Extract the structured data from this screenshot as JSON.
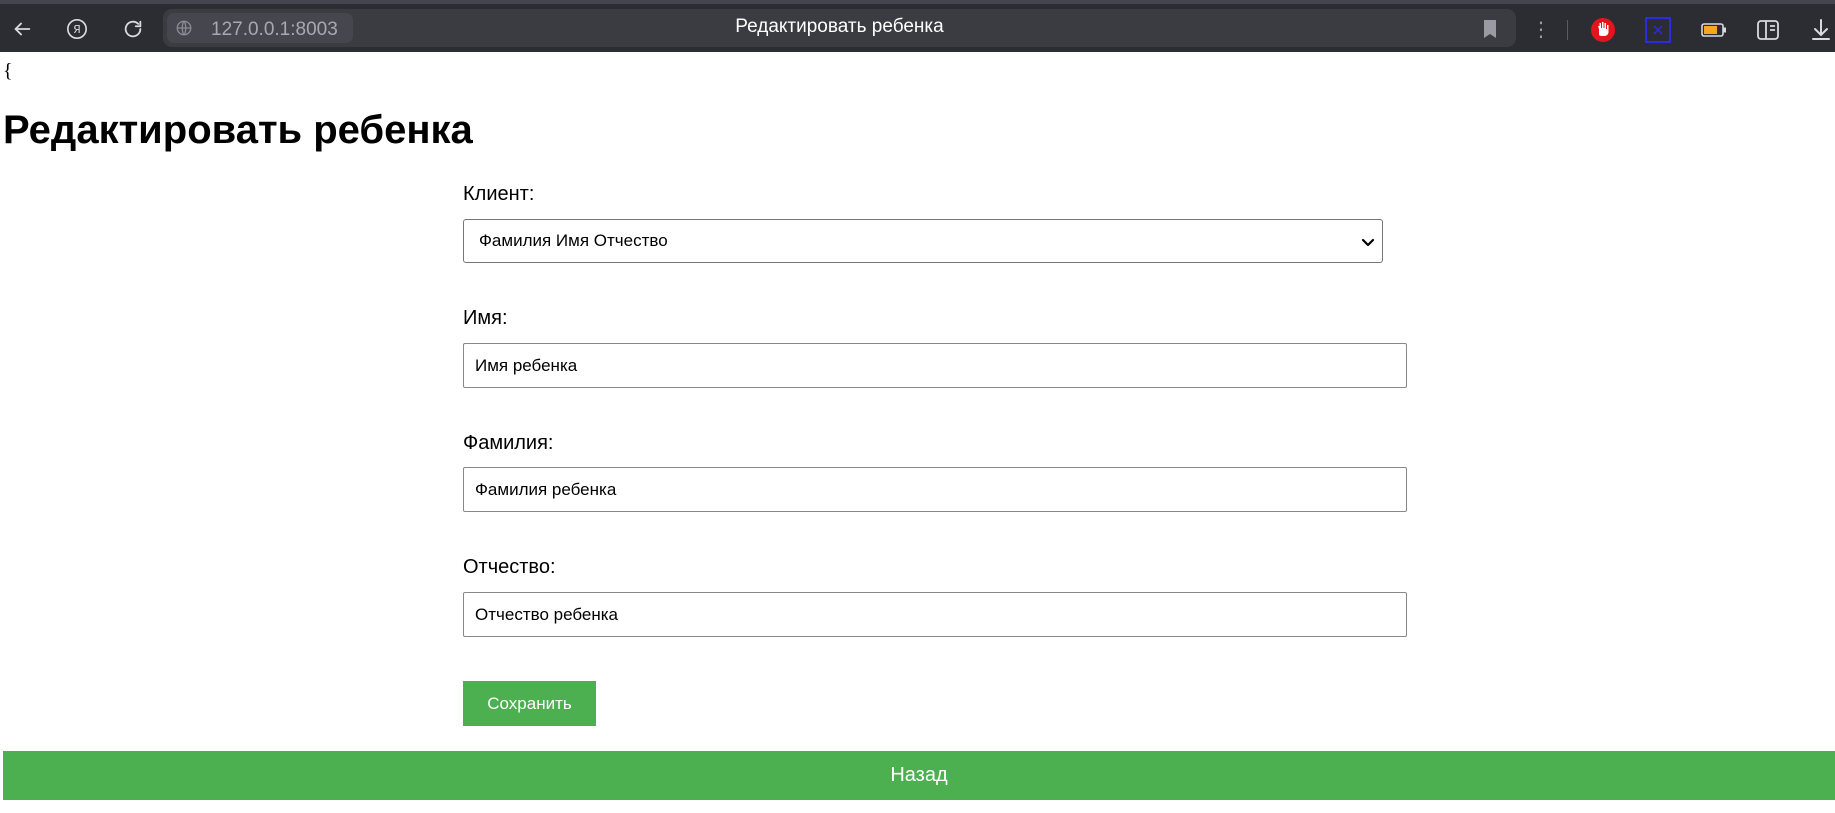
{
  "browser": {
    "url": "127.0.0.1:8003",
    "tab_title": "Редактировать ребенка",
    "icons": [
      "back-icon",
      "yandex-icon",
      "reload-icon",
      "globe-icon",
      "bookmark-icon",
      "menu-icon",
      "adblock-icon",
      "extension-icon",
      "battery-icon",
      "sidebar-icon",
      "download-icon"
    ],
    "adblock_color": "#e3141c",
    "battery_color": "#f5a623"
  },
  "page": {
    "brace": "{",
    "title": "Редактировать ребенка"
  },
  "form": {
    "client_label": "Клиент:",
    "client_selected": "Фамилия Имя Отчество",
    "first_name_label": "Имя:",
    "first_name_value": "Имя ребенка",
    "last_name_label": "Фамилия:",
    "last_name_value": "Фамилия ребенка",
    "patronymic_label": "Отчество:",
    "patronymic_value": "Отчество ребенка",
    "save_label": "Сохранить"
  },
  "footer": {
    "back_label": "Назад"
  },
  "colors": {
    "accent": "#4caf50",
    "chrome_bg": "#2c2c33"
  }
}
